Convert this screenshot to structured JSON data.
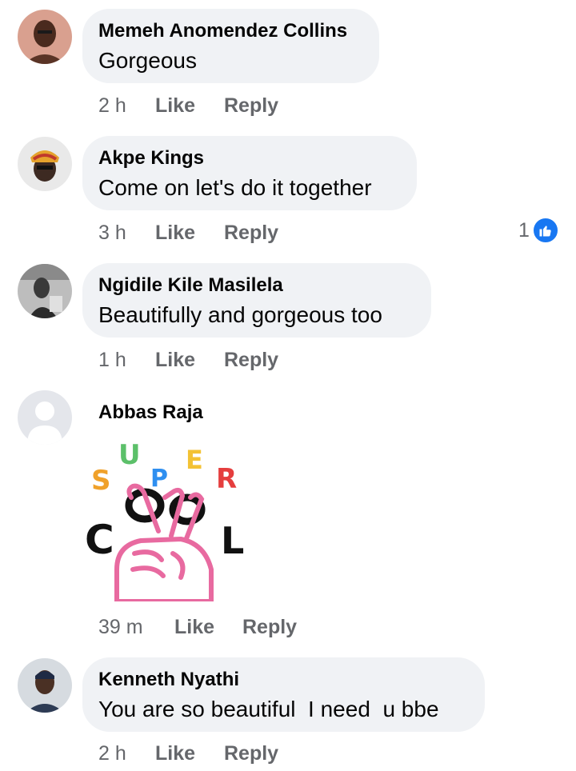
{
  "comments": [
    {
      "name": "Memeh Anomendez Collins",
      "text": "Gorgeous",
      "time": "2 h",
      "like": "Like",
      "reply": "Reply"
    },
    {
      "name": "Akpe Kings",
      "text": "Come on let's do it together",
      "time": "3 h",
      "like": "Like",
      "reply": "Reply",
      "reaction_count": "1",
      "reaction_icon": "thumbs-up-icon"
    },
    {
      "name": "Ngidile Kile Masilela",
      "text": "Beautifully and gorgeous too",
      "time": "1 h",
      "like": "Like",
      "reply": "Reply"
    },
    {
      "name": "Abbas Raja",
      "sticker": {
        "word1": "SUPER",
        "word2": "COOL",
        "letters1": [
          "S",
          "U",
          "P",
          "E",
          "R"
        ],
        "letters2": [
          "C",
          "O",
          "O",
          "L"
        ]
      },
      "time": "39 m",
      "like": "Like",
      "reply": "Reply"
    },
    {
      "name": "Kenneth Nyathi",
      "text": "You are so beautiful  I need  u bbe",
      "time": "2 h",
      "like": "Like",
      "reply": "Reply"
    }
  ],
  "colors": {
    "bubble": "#f0f2f5",
    "meta_text": "#65676b",
    "like_badge": "#1877f2",
    "sticker_pink": "#e86aa0"
  }
}
